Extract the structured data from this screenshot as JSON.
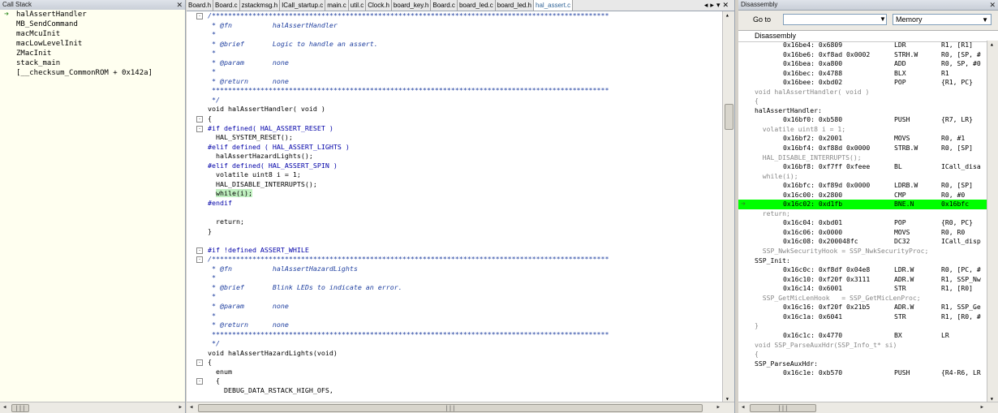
{
  "callstack": {
    "title": "Call Stack",
    "items": [
      "halAssertHandler",
      "MB_SendCommand",
      "macMcuInit",
      "macLowLevelInit",
      "ZMacInit",
      "stack_main",
      "[__checksum_CommonROM + 0x142a]"
    ]
  },
  "editor": {
    "tabs": [
      "Board.h",
      "Board.c",
      "zstackmsg.h",
      "ICall_startup.c",
      "main.c",
      "util.c",
      "Clock.h",
      "board_key.h",
      "Board.c",
      "board_led.c",
      "board_led.h",
      "hal_assert.c"
    ],
    "active_tab": 11,
    "lines": [
      {
        "t": "/**************************************************************************************************",
        "k": "cmt",
        "f": "-"
      },
      {
        "t": " * @fn          halAssertHandler",
        "k": "cmt"
      },
      {
        "t": " *",
        "k": "cmt"
      },
      {
        "t": " * @brief       Logic to handle an assert.",
        "k": "cmt"
      },
      {
        "t": " *",
        "k": "cmt"
      },
      {
        "t": " * @param       none",
        "k": "cmt"
      },
      {
        "t": " *",
        "k": "cmt"
      },
      {
        "t": " * @return      none",
        "k": "cmt"
      },
      {
        "t": " **************************************************************************************************",
        "k": "cmt"
      },
      {
        "t": " */",
        "k": "cmt"
      },
      {
        "t": "void halAssertHandler( void )",
        "k": ""
      },
      {
        "t": "{",
        "k": "",
        "f": "-"
      },
      {
        "t": "#if defined( HAL_ASSERT_RESET )",
        "k": "pp",
        "f": "-"
      },
      {
        "t": "  HAL_SYSTEM_RESET();",
        "k": ""
      },
      {
        "t": "#elif defined ( HAL_ASSERT_LIGHTS )",
        "k": "pp"
      },
      {
        "t": "  halAssertHazardLights();",
        "k": ""
      },
      {
        "t": "#elif defined( HAL_ASSERT_SPIN )",
        "k": "pp"
      },
      {
        "t": "  volatile uint8 i = 1;",
        "k": ""
      },
      {
        "t": "  HAL_DISABLE_INTERRUPTS();",
        "k": ""
      },
      {
        "t": "  while(i);",
        "k": "",
        "h": true
      },
      {
        "t": "#endif",
        "k": "pp"
      },
      {
        "t": "",
        "k": ""
      },
      {
        "t": "  return;",
        "k": ""
      },
      {
        "t": "}",
        "k": ""
      },
      {
        "t": "",
        "k": ""
      },
      {
        "t": "#if !defined ASSERT_WHILE",
        "k": "pp",
        "f": "-"
      },
      {
        "t": "/**************************************************************************************************",
        "k": "cmt",
        "f": "-"
      },
      {
        "t": " * @fn          halAssertHazardLights",
        "k": "cmt"
      },
      {
        "t": " *",
        "k": "cmt"
      },
      {
        "t": " * @brief       Blink LEDs to indicate an error.",
        "k": "cmt"
      },
      {
        "t": " *",
        "k": "cmt"
      },
      {
        "t": " * @param       none",
        "k": "cmt"
      },
      {
        "t": " *",
        "k": "cmt"
      },
      {
        "t": " * @return      none",
        "k": "cmt"
      },
      {
        "t": " **************************************************************************************************",
        "k": "cmt"
      },
      {
        "t": " */",
        "k": "cmt"
      },
      {
        "t": "void halAssertHazardLights(void)",
        "k": ""
      },
      {
        "t": "{",
        "k": "",
        "f": "-"
      },
      {
        "t": "  enum",
        "k": ""
      },
      {
        "t": "  {",
        "k": "",
        "f": "-"
      },
      {
        "t": "    DEBUG_DATA_RSTACK_HIGH_OFS,",
        "k": ""
      }
    ]
  },
  "disasm": {
    "title": "Disassembly",
    "goto_label": "Go to",
    "goto_value": "",
    "memory_label": "Memory",
    "header": "Disassembly",
    "lines": [
      {
        "k": "ins",
        "a": "0x16be4: 0x6809",
        "m": "LDR",
        "o": "R1, [R1]"
      },
      {
        "k": "ins",
        "a": "0x16be6: 0xf8ad 0x0002",
        "m": "STRH.W",
        "o": "R0, [SP, #"
      },
      {
        "k": "ins",
        "a": "0x16bea: 0xa800",
        "m": "ADD",
        "o": "R0, SP, #0"
      },
      {
        "k": "ins",
        "a": "0x16bec: 0x4788",
        "m": "BLX",
        "o": "R1"
      },
      {
        "k": "ins",
        "a": "0x16bee: 0xbd02",
        "m": "POP",
        "o": "{R1, PC}"
      },
      {
        "k": "src",
        "t": "void halAssertHandler( void )"
      },
      {
        "k": "src",
        "t": "{"
      },
      {
        "k": "lbl",
        "t": "halAssertHandler:"
      },
      {
        "k": "ins",
        "a": "0x16bf0: 0xb580",
        "m": "PUSH",
        "o": "{R7, LR}"
      },
      {
        "k": "src",
        "t": "  volatile uint8 i = 1;"
      },
      {
        "k": "ins",
        "a": "0x16bf2: 0x2001",
        "m": "MOVS",
        "o": "R0, #1"
      },
      {
        "k": "ins",
        "a": "0x16bf4: 0xf88d 0x0000",
        "m": "STRB.W",
        "o": "R0, [SP]"
      },
      {
        "k": "src",
        "t": "  HAL_DISABLE_INTERRUPTS();"
      },
      {
        "k": "ins",
        "a": "0x16bf8: 0xf7ff 0xfeee",
        "m": "BL",
        "o": "ICall_disa"
      },
      {
        "k": "src",
        "t": "  while(i);"
      },
      {
        "k": "ins",
        "a": "0x16bfc: 0xf89d 0x0000",
        "m": "LDRB.W",
        "o": "R0, [SP]"
      },
      {
        "k": "ins",
        "a": "0x16c00: 0x2800",
        "m": "CMP",
        "o": "R0, #0"
      },
      {
        "k": "cur",
        "a": "0x16c02: 0xd1fb",
        "m": "BNE.N",
        "o": "0x16bfc"
      },
      {
        "k": "src",
        "t": "  return;"
      },
      {
        "k": "ins",
        "a": "0x16c04: 0xbd01",
        "m": "POP",
        "o": "{R0, PC}"
      },
      {
        "k": "ins",
        "a": "0x16c06: 0x0000",
        "m": "MOVS",
        "o": "R0, R0"
      },
      {
        "k": "ins",
        "a": "0x16c08: 0x200048fc",
        "m": "DC32",
        "o": "ICall_disp"
      },
      {
        "k": "src",
        "t": "  SSP_NwkSecurityHook = SSP_NwkSecurityProc;"
      },
      {
        "k": "lbl",
        "t": "SSP_Init:"
      },
      {
        "k": "ins",
        "a": "0x16c0c: 0xf8df 0x04e8",
        "m": "LDR.W",
        "o": "R0, [PC, #"
      },
      {
        "k": "ins",
        "a": "0x16c10: 0xf20f 0x3111",
        "m": "ADR.W",
        "o": "R1, SSP_Nw"
      },
      {
        "k": "ins",
        "a": "0x16c14: 0x6001",
        "m": "STR",
        "o": "R1, [R0]"
      },
      {
        "k": "src",
        "t": "  SSP_GetMicLenHook   = SSP_GetMicLenProc;"
      },
      {
        "k": "ins",
        "a": "0x16c16: 0xf20f 0x21b5",
        "m": "ADR.W",
        "o": "R1, SSP_Ge"
      },
      {
        "k": "ins",
        "a": "0x16c1a: 0x6041",
        "m": "STR",
        "o": "R1, [R0, #"
      },
      {
        "k": "src",
        "t": "}"
      },
      {
        "k": "ins",
        "a": "0x16c1c: 0x4770",
        "m": "BX",
        "o": "LR"
      },
      {
        "k": "src",
        "t": "void SSP_ParseAuxHdr(SSP_Info_t* si)"
      },
      {
        "k": "src",
        "t": "{"
      },
      {
        "k": "lbl",
        "t": "SSP_ParseAuxHdr:"
      },
      {
        "k": "ins",
        "a": "0x16c1e: 0xb570",
        "m": "PUSH",
        "o": "{R4-R6, LR"
      }
    ]
  },
  "colors": {
    "current_line": "#00ff00",
    "comment": "#2040a0",
    "preproc": "#0000a8",
    "arrow": "#2e8b20"
  }
}
